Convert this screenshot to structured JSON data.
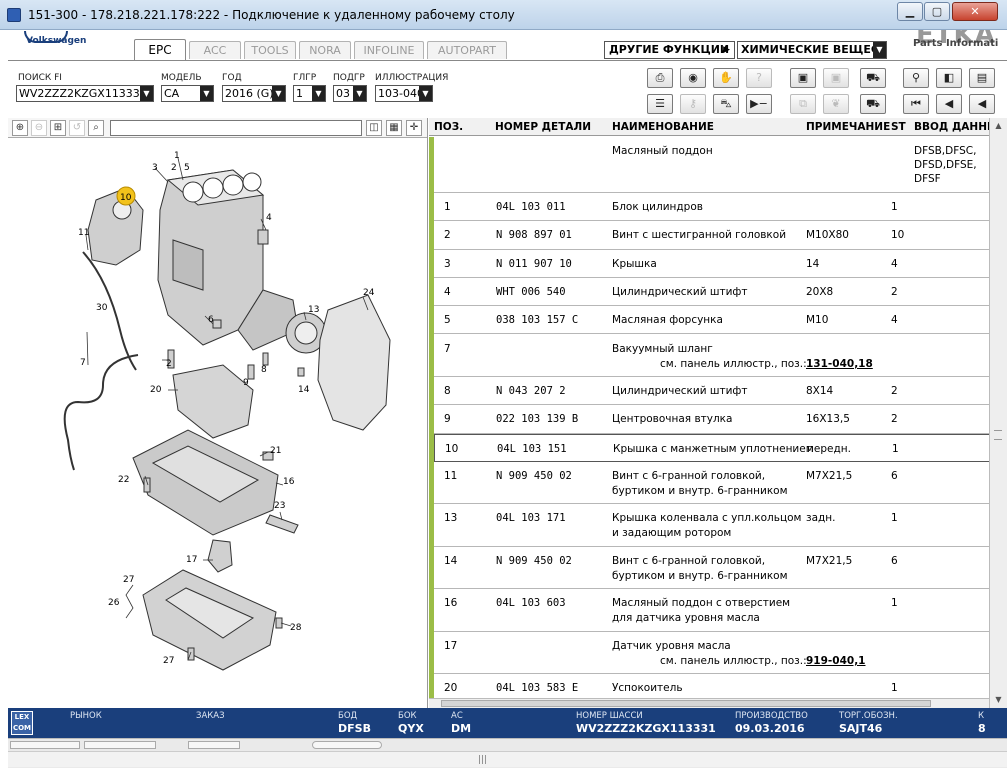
{
  "window": {
    "title": "151-300 - 178.218.221.178:222 - Подключение к удаленному рабочему столу",
    "min_label": "▁",
    "max_label": "▢",
    "close_label": "✕"
  },
  "brand": {
    "vw_label": "Volkswagen",
    "etka_top": "ETKA",
    "etka_label": "Parts Informati"
  },
  "tabs": [
    {
      "label": "EPC",
      "active": true
    },
    {
      "label": "ACC"
    },
    {
      "label": "TOOLS"
    },
    {
      "label": "NORA"
    },
    {
      "label": "INFOLINE"
    },
    {
      "label": "AUTOPART"
    }
  ],
  "functions": {
    "label": "ДРУГИЕ ФУНКЦИИ",
    "arrow": "▶",
    "selector_value": "ХИМИЧЕСКИЕ ВЕЩЕС"
  },
  "filters": {
    "search": {
      "label": "ПОИСК FI",
      "value": "WV2ZZZ2KZGX113331"
    },
    "model": {
      "label": "МОДЕЛЬ",
      "value": "CA"
    },
    "year": {
      "label": "ГОД",
      "value": "2016 (G)"
    },
    "mg": {
      "label": "ГЛГР",
      "value": "1"
    },
    "sg": {
      "label": "ПОДГР",
      "value": "03"
    },
    "illus": {
      "label": "ИЛЛЮСТРАЦИЯ",
      "value": "103-040"
    }
  },
  "toolbar_icons": {
    "print": "print-icon",
    "camera": "camera-icon",
    "handshake": "handshake-icon",
    "help": "help-icon",
    "elsa": "elsa-icon",
    "dsr": "dsr-icon",
    "cart_top": "cart-icon",
    "pin": "pin-icon",
    "page": "page-icon",
    "list": "list-icon",
    "key": "key-icon",
    "car": "car-icon",
    "arrow_line": "arrow-line-icon",
    "copy": "copy-icon",
    "leaf": "leaf-icon",
    "cart_bottom": "cart-icon",
    "first": "first-icon",
    "prev": "prev-icon",
    "back": "back-icon"
  },
  "table": {
    "headers": {
      "pos": "ПОЗ.",
      "part": "НОМЕР ДЕТАЛИ",
      "name": "НАИМЕНОВАНИЕ",
      "note": "ПРИМЕЧАНИЕ",
      "st": "ST",
      "input": "ВВОД ДАННЫХ"
    },
    "rows": [
      {
        "pos": "",
        "part": "",
        "name": "Масляный поддон",
        "name2": "",
        "note": "",
        "link": "",
        "st": "",
        "input": "DFSB,DFSC,",
        "input2": "DFSD,DFSE,",
        "input3": "DFSF"
      },
      {
        "pos": "1",
        "part": "04L  103  011",
        "name": "Блок цилиндров",
        "name2": "",
        "note": "",
        "link": "",
        "st": "1",
        "input": "",
        "input2": "",
        "input3": ""
      },
      {
        "pos": "2",
        "part": "N    908  897  01",
        "name": "Винт с шестигранной головкой",
        "name2": "",
        "note": "M10X80",
        "link": "",
        "st": "10",
        "input": "",
        "input2": "",
        "input3": ""
      },
      {
        "pos": "3",
        "part": "N    011  907  10",
        "name": "Крышка",
        "name2": "",
        "note": "14",
        "link": "",
        "st": "4",
        "input": "",
        "input2": "",
        "input3": ""
      },
      {
        "pos": "4",
        "part": "WHT  006  540",
        "name": "Цилиндрический штифт",
        "name2": "",
        "note": "20X8",
        "link": "",
        "st": "2",
        "input": "",
        "input2": "",
        "input3": ""
      },
      {
        "pos": "5",
        "part": "038  103  157  C",
        "name": "Масляная форсунка",
        "name2": "",
        "note": "M10",
        "link": "",
        "st": "4",
        "input": "",
        "input2": "",
        "input3": ""
      },
      {
        "pos": "7",
        "part": "",
        "name": "Вакуумный шланг",
        "name2": "см. панель иллюстр., поз.:",
        "note": "",
        "link": "131-040,18",
        "st": "",
        "input": "",
        "input2": "",
        "input3": ""
      },
      {
        "pos": "8",
        "part": "N    043  207  2",
        "name": "Цилиндрический штифт",
        "name2": "",
        "note": "8X14",
        "link": "",
        "st": "2",
        "input": "",
        "input2": "",
        "input3": ""
      },
      {
        "pos": "9",
        "part": "022  103  139  B",
        "name": "Центровочная втулка",
        "name2": "",
        "note": "16X13,5",
        "link": "",
        "st": "2",
        "input": "",
        "input2": "",
        "input3": ""
      },
      {
        "pos": "10",
        "part": "04L  103  151",
        "name": "Крышка с манжетным уплотнением",
        "name2": "",
        "note": "передн.",
        "link": "",
        "st": "1",
        "input": "",
        "input2": "",
        "input3": ""
      },
      {
        "pos": "11",
        "part": "N    909  450  02",
        "name": "Винт с 6-гранной головкой,",
        "name2": "буртиком и внутр. 6-гранником",
        "note": "M7X21,5",
        "link": "",
        "st": "6",
        "input": "",
        "input2": "",
        "input3": ""
      },
      {
        "pos": "13",
        "part": "04L  103  171",
        "name": "Крышка коленвала с упл.кольцом",
        "name2": "и задающим ротором",
        "note": "задн.",
        "link": "",
        "st": "1",
        "input": "",
        "input2": "",
        "input3": ""
      },
      {
        "pos": "14",
        "part": "N    909  450  02",
        "name": "Винт с 6-гранной головкой,",
        "name2": "буртиком и внутр. 6-гранником",
        "note": "M7X21,5",
        "link": "",
        "st": "6",
        "input": "",
        "input2": "",
        "input3": ""
      },
      {
        "pos": "16",
        "part": "04L  103  603",
        "name": "Масляный поддон с отверстием",
        "name2": "для датчика уровня масла",
        "note": "",
        "link": "",
        "st": "1",
        "input": "",
        "input2": "",
        "input3": ""
      },
      {
        "pos": "17",
        "part": "",
        "name": "Датчик уровня масла",
        "name2": "см. панель иллюстр., поз.:",
        "note": "",
        "link": "919-040,1",
        "st": "",
        "input": "",
        "input2": "",
        "input3": ""
      },
      {
        "pos": "20",
        "part": "04L  103  583  E",
        "name": "Успокоитель",
        "name2": "",
        "note": "",
        "link": "",
        "st": "1",
        "input": "",
        "input2": "",
        "input3": ""
      }
    ]
  },
  "diagram": {
    "callouts": [
      "1",
      "2",
      "3",
      "4",
      "5",
      "6",
      "7",
      "8",
      "9",
      "10",
      "11",
      "13",
      "14",
      "16",
      "17",
      "20",
      "21",
      "22",
      "23",
      "24",
      "26",
      "27",
      "28",
      "30"
    ],
    "highlight_callout": "10"
  },
  "status": {
    "market": {
      "label": "РЫНОК",
      "value": ""
    },
    "order": {
      "label": "ЗАКАЗ",
      "value": ""
    },
    "bod": {
      "label": "БОД",
      "value": "DFSB"
    },
    "bok": {
      "label": "БОК",
      "value": "QYX"
    },
    "ac": {
      "label": "АС",
      "value": "DM"
    },
    "chassis": {
      "label": "НОМЕР ШАССИ",
      "value": "WV2ZZZ2KZGX113331"
    },
    "production": {
      "label": "ПРОИЗВОДСТВО",
      "value": "09.03.2016"
    },
    "tradename": {
      "label": "ТОРГ.ОБОЗН.",
      "value": "SAJT46"
    },
    "k": {
      "label": "К",
      "value": "8"
    }
  },
  "lexcom": {
    "line1": "LEX",
    "line2": "COM"
  },
  "colors": {
    "accent": "#1a3f7c",
    "green_bar": "#9bbd47",
    "highlight": "#f2c21b"
  }
}
